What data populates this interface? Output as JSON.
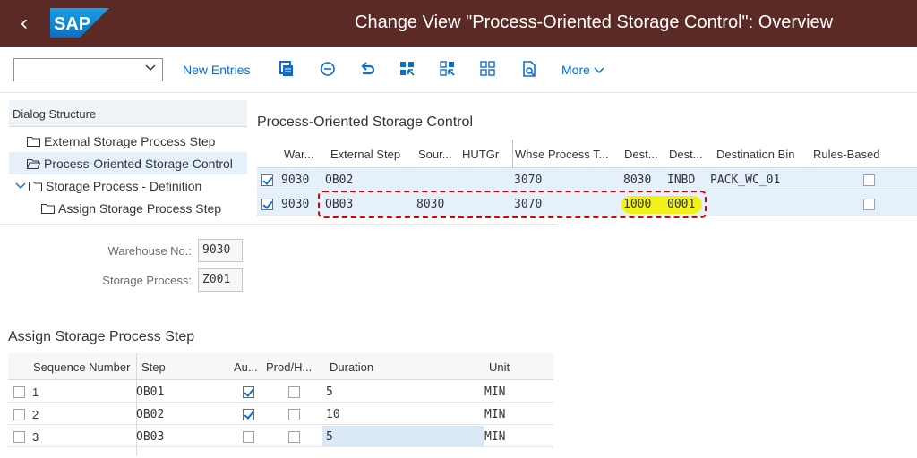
{
  "shell": {
    "title": "Change View \"Process-Oriented Storage Control\": Overview",
    "logo_text": "SAP"
  },
  "toolbar": {
    "new_entries": "New Entries",
    "more": "More"
  },
  "dialog_structure": {
    "header": "Dialog Structure",
    "items": [
      {
        "label": "External Storage Process Step"
      },
      {
        "label": "Process-Oriented Storage Control"
      },
      {
        "label": "Storage Process - Definition"
      },
      {
        "label": "Assign Storage Process Step"
      }
    ]
  },
  "main": {
    "title": "Process-Oriented Storage Control",
    "columns": [
      "War...",
      "External Step",
      "Sour...",
      "HUTGr",
      "Whse Process T...",
      "Dest...",
      "Dest...",
      "Destination Bin",
      "Rules-Based"
    ],
    "rows": [
      {
        "warehouse": "9030",
        "ext_step": "OB02",
        "source": "",
        "hutgr": "",
        "whse_process_type": "3070",
        "dest1": "8030",
        "dest2": "INBD",
        "dest_bin": "PACK_WC_01",
        "selected": true,
        "rules_based": false
      },
      {
        "warehouse": "9030",
        "ext_step": "OB03",
        "source": "8030",
        "hutgr": "",
        "whse_process_type": "3070",
        "dest1": "1000",
        "dest2": "0001",
        "dest_bin": "",
        "selected": true,
        "rules_based": false
      }
    ]
  },
  "form": {
    "warehouse_label": "Warehouse No.:",
    "warehouse_value": "9030",
    "storage_process_label": "Storage Process:",
    "storage_process_value": "Z001"
  },
  "assign": {
    "title": "Assign Storage Process Step",
    "columns": [
      "Sequence Number",
      "Step",
      "Au...",
      "Prod/H...",
      "Duration",
      "Unit"
    ],
    "rows": [
      {
        "seq": "1",
        "step": "OB01",
        "auto": true,
        "prod": false,
        "duration": "5",
        "unit": "MIN"
      },
      {
        "seq": "2",
        "step": "OB02",
        "auto": true,
        "prod": false,
        "duration": "10",
        "unit": "MIN"
      },
      {
        "seq": "3",
        "step": "OB03",
        "auto": false,
        "prod": false,
        "duration": "5",
        "unit": "MIN"
      }
    ]
  },
  "colors": {
    "shell": "#5c2a24",
    "link": "#0a6ed1",
    "highlight": "#f2f21a",
    "annotation": "#e00000"
  }
}
